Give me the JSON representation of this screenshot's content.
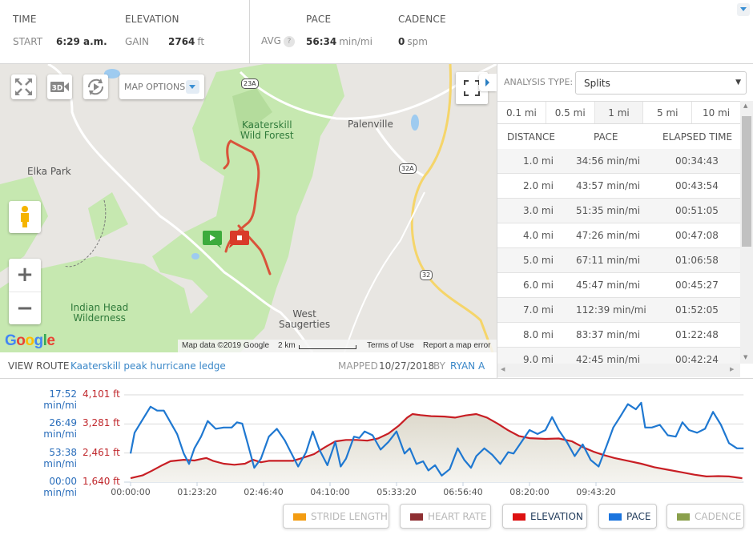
{
  "stats": {
    "time": {
      "heading": "TIME",
      "sub_label": "START",
      "value": "6:29 a.m."
    },
    "elevation": {
      "heading": "ELEVATION",
      "sub_label": "GAIN",
      "value": "2764",
      "unit": "ft"
    },
    "pace": {
      "heading": "PACE",
      "sub_label": "AVG",
      "help": "?",
      "value": "56:34",
      "unit": "min/mi"
    },
    "cadence": {
      "heading": "CADENCE",
      "value": "0",
      "unit": "spm"
    },
    "collapse_icon": "caret-down-icon"
  },
  "map": {
    "controls": {
      "fullscreen_icon": "expand-arrows-icon",
      "three_d_label": "3D",
      "replay_icon": "rotate-play-icon",
      "map_options_label": "MAP OPTIONS",
      "zoom_in": "+",
      "zoom_out": "−",
      "pegman_icon": "street-view-icon",
      "fit_icon": "fit-bounds-icon"
    },
    "places": {
      "kaaterskill_1": "Kaaterskill",
      "kaaterskill_2": "Wild Forest",
      "palenville": "Palenville",
      "elka_park": "Elka Park",
      "indian_head_1": "Indian Head",
      "indian_head_2": "Wilderness",
      "west_saugerties_1": "West",
      "west_saugerties_2": "Saugerties"
    },
    "shields": {
      "r23a": "23A",
      "r32a": "32A",
      "r32": "32"
    },
    "footer": {
      "map_data": "Map data ©2019 Google",
      "scale": "2 km",
      "terms": "Terms of Use",
      "report": "Report a map error"
    },
    "logo": "Google",
    "colors": {
      "route": "#d9533a",
      "start": "#3cab3c",
      "end": "#d93a2a"
    }
  },
  "route": {
    "view_label": "VIEW ROUTE",
    "name": "Kaaterskill peak hurricane ledge",
    "mapped_label": "MAPPED",
    "mapped_date": "10/27/2018",
    "by_label": "BY",
    "author": "RYAN A"
  },
  "analysis": {
    "type_label": "ANALYSIS TYPE:",
    "type_value": "Splits",
    "split_tabs": [
      {
        "label": "0.1 mi",
        "active": false
      },
      {
        "label": "0.5 mi",
        "active": false
      },
      {
        "label": "1 mi",
        "active": true
      },
      {
        "label": "5 mi",
        "active": false
      },
      {
        "label": "10 mi",
        "active": false
      }
    ],
    "columns": [
      "DISTANCE",
      "PACE",
      "ELAPSED TIME"
    ],
    "rows": [
      {
        "distance": "1.0 mi",
        "pace": "34:56 min/mi",
        "elapsed": "00:34:43"
      },
      {
        "distance": "2.0 mi",
        "pace": "43:57 min/mi",
        "elapsed": "00:43:54"
      },
      {
        "distance": "3.0 mi",
        "pace": "51:35 min/mi",
        "elapsed": "00:51:05"
      },
      {
        "distance": "4.0 mi",
        "pace": "47:26 min/mi",
        "elapsed": "00:47:08"
      },
      {
        "distance": "5.0 mi",
        "pace": "67:11 min/mi",
        "elapsed": "01:06:58"
      },
      {
        "distance": "6.0 mi",
        "pace": "45:47 min/mi",
        "elapsed": "00:45:27"
      },
      {
        "distance": "7.0 mi",
        "pace": "112:39 min/mi",
        "elapsed": "01:52:05"
      },
      {
        "distance": "8.0 mi",
        "pace": "83:37 min/mi",
        "elapsed": "01:22:48"
      },
      {
        "distance": "9.0 mi",
        "pace": "42:45 min/mi",
        "elapsed": "00:42:24"
      }
    ]
  },
  "chart_data": {
    "type": "line",
    "title": "",
    "xlabel": "",
    "x_unit": "elapsed seconds",
    "x_range": [
      0,
      46100
    ],
    "x_ticks": [
      {
        "value": 0,
        "label": "00:00:00"
      },
      {
        "value": 5000,
        "label": "01:23:20"
      },
      {
        "value": 10000,
        "label": "02:46:40"
      },
      {
        "value": 15000,
        "label": "04:10:00"
      },
      {
        "value": 20000,
        "label": "05:33:20"
      },
      {
        "value": 25000,
        "label": "06:56:40"
      },
      {
        "value": 30000,
        "label": "08:20:00"
      },
      {
        "value": 35000,
        "label": "09:43:20"
      }
    ],
    "y_left_pace_labels": [
      "00:00 min/mi",
      "53:38 min/mi",
      "26:49 min/mi",
      "17:52 min/mi"
    ],
    "y_left_elev_labels": [
      "1,640 ft",
      "2,461 ft",
      "3,281 ft",
      "4,101 ft"
    ],
    "elevation_range_ft": [
      1640,
      4101
    ],
    "pace_speed_range_mph": [
      0,
      3.356
    ],
    "grid": true,
    "series": [
      {
        "name": "Elevation",
        "unit": "ft",
        "color": "#c81e24",
        "filled": true,
        "points": [
          [
            0,
            1750
          ],
          [
            900,
            1830
          ],
          [
            1600,
            1960
          ],
          [
            2400,
            2120
          ],
          [
            3000,
            2230
          ],
          [
            4000,
            2270
          ],
          [
            4800,
            2250
          ],
          [
            5400,
            2300
          ],
          [
            5700,
            2320
          ],
          [
            6200,
            2240
          ],
          [
            7000,
            2160
          ],
          [
            7800,
            2130
          ],
          [
            8600,
            2160
          ],
          [
            9200,
            2270
          ],
          [
            9800,
            2200
          ],
          [
            10400,
            2240
          ],
          [
            11200,
            2240
          ],
          [
            12200,
            2240
          ],
          [
            13000,
            2330
          ],
          [
            13800,
            2430
          ],
          [
            14600,
            2620
          ],
          [
            15400,
            2790
          ],
          [
            16200,
            2830
          ],
          [
            17000,
            2830
          ],
          [
            17800,
            2810
          ],
          [
            18600,
            2870
          ],
          [
            19400,
            3010
          ],
          [
            20200,
            3240
          ],
          [
            20800,
            3460
          ],
          [
            21200,
            3560
          ],
          [
            21800,
            3530
          ],
          [
            22600,
            3500
          ],
          [
            23600,
            3490
          ],
          [
            24400,
            3460
          ],
          [
            25200,
            3520
          ],
          [
            26000,
            3560
          ],
          [
            26800,
            3460
          ],
          [
            27600,
            3290
          ],
          [
            28400,
            3100
          ],
          [
            29200,
            2940
          ],
          [
            30000,
            2880
          ],
          [
            31200,
            2860
          ],
          [
            32200,
            2870
          ],
          [
            33200,
            2790
          ],
          [
            34000,
            2630
          ],
          [
            34800,
            2500
          ],
          [
            35600,
            2400
          ],
          [
            36400,
            2320
          ],
          [
            37400,
            2240
          ],
          [
            38400,
            2160
          ],
          [
            39400,
            2060
          ],
          [
            40400,
            1990
          ],
          [
            41400,
            1920
          ],
          [
            42400,
            1850
          ],
          [
            43300,
            1800
          ],
          [
            44200,
            1810
          ],
          [
            45000,
            1800
          ],
          [
            46000,
            1750
          ]
        ]
      },
      {
        "name": "Pace",
        "unit": "mph (plotted as speed)",
        "color": "#1f78d1",
        "filled": false,
        "points": [
          [
            0,
            1.1
          ],
          [
            300,
            1.9
          ],
          [
            900,
            2.4
          ],
          [
            1500,
            2.9
          ],
          [
            2000,
            2.75
          ],
          [
            2500,
            2.75
          ],
          [
            3000,
            2.3
          ],
          [
            3500,
            1.85
          ],
          [
            4000,
            1.1
          ],
          [
            4400,
            0.7
          ],
          [
            4800,
            1.3
          ],
          [
            5300,
            1.75
          ],
          [
            5800,
            2.35
          ],
          [
            6400,
            2.05
          ],
          [
            7000,
            2.1
          ],
          [
            7600,
            2.1
          ],
          [
            8000,
            2.3
          ],
          [
            8400,
            2.25
          ],
          [
            8800,
            1.5
          ],
          [
            9300,
            0.55
          ],
          [
            9800,
            0.9
          ],
          [
            10400,
            1.75
          ],
          [
            11000,
            2.05
          ],
          [
            11600,
            1.6
          ],
          [
            12000,
            1.2
          ],
          [
            12600,
            0.6
          ],
          [
            13200,
            1.15
          ],
          [
            13700,
            1.95
          ],
          [
            14200,
            1.25
          ],
          [
            14800,
            0.65
          ],
          [
            15400,
            1.55
          ],
          [
            15800,
            0.6
          ],
          [
            16200,
            0.9
          ],
          [
            16800,
            1.75
          ],
          [
            17200,
            1.7
          ],
          [
            17600,
            1.95
          ],
          [
            18200,
            1.8
          ],
          [
            18800,
            1.25
          ],
          [
            19400,
            1.55
          ],
          [
            20000,
            1.95
          ],
          [
            20600,
            1.1
          ],
          [
            21000,
            1.3
          ],
          [
            21500,
            0.7
          ],
          [
            22000,
            0.8
          ],
          [
            22400,
            0.45
          ],
          [
            22900,
            0.65
          ],
          [
            23400,
            0.25
          ],
          [
            24000,
            0.5
          ],
          [
            24600,
            1.3
          ],
          [
            25100,
            0.85
          ],
          [
            25600,
            0.55
          ],
          [
            26000,
            1.0
          ],
          [
            26600,
            1.3
          ],
          [
            27200,
            1.05
          ],
          [
            27800,
            0.7
          ],
          [
            28400,
            1.15
          ],
          [
            28800,
            1.1
          ],
          [
            29400,
            1.55
          ],
          [
            30000,
            2.0
          ],
          [
            30600,
            1.85
          ],
          [
            31200,
            2.0
          ],
          [
            31700,
            2.5
          ],
          [
            32200,
            2.0
          ],
          [
            32800,
            1.55
          ],
          [
            33400,
            1.0
          ],
          [
            34000,
            1.45
          ],
          [
            34600,
            0.85
          ],
          [
            35200,
            0.6
          ],
          [
            35800,
            1.4
          ],
          [
            36300,
            2.1
          ],
          [
            36800,
            2.5
          ],
          [
            37400,
            3.0
          ],
          [
            38000,
            2.8
          ],
          [
            38400,
            3.05
          ],
          [
            38700,
            2.1
          ],
          [
            39200,
            2.1
          ],
          [
            39800,
            2.2
          ],
          [
            40400,
            1.8
          ],
          [
            41000,
            1.75
          ],
          [
            41500,
            2.3
          ],
          [
            42000,
            2.0
          ],
          [
            42600,
            1.9
          ],
          [
            43200,
            2.05
          ],
          [
            43800,
            2.7
          ],
          [
            44400,
            2.2
          ],
          [
            45000,
            1.5
          ],
          [
            45600,
            1.3
          ],
          [
            46100,
            1.3
          ]
        ]
      }
    ]
  },
  "legend": [
    {
      "label": "STRIDE LENGTH",
      "color": "#f39c12",
      "active": false
    },
    {
      "label": "HEART RATE",
      "color": "#8e2f32",
      "active": false
    },
    {
      "label": "ELEVATION",
      "color": "#dd1111",
      "active": true
    },
    {
      "label": "PACE",
      "color": "#1a74de",
      "active": true
    },
    {
      "label": "CADENCE",
      "color": "#8aa04c",
      "active": false
    }
  ]
}
